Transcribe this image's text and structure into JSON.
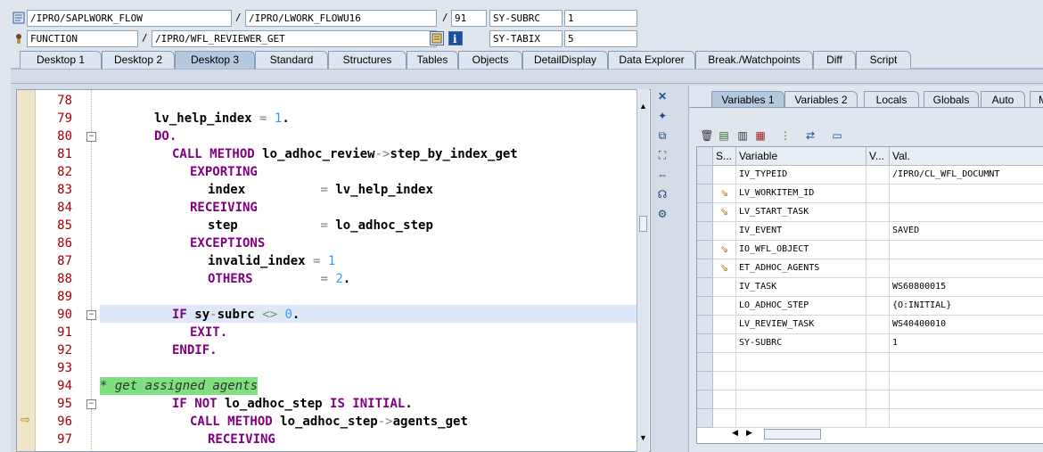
{
  "top": {
    "row1": {
      "program": "/IPRO/SAPLWORK_FLOW",
      "include": "/IPRO/LWORK_FLOWU16",
      "line": "91",
      "var_name": "SY-SUBRC",
      "var_value": "1"
    },
    "row2": {
      "type": "FUNCTION",
      "name": "/IPRO/WFL_REVIEWER_GET",
      "var_name": "SY-TABIX",
      "var_value": "5"
    },
    "slash": "/"
  },
  "desktop_tabs": [
    "Desktop 1",
    "Desktop 2",
    "Desktop 3",
    "Standard",
    "Structures",
    "Tables",
    "Objects",
    "DetailDisplay",
    "Data Explorer",
    "Break./Watchpoints",
    "Diff",
    "Script"
  ],
  "active_desktop_tab": "Desktop 3",
  "code_lines": [
    {
      "num": "78",
      "text": ""
    },
    {
      "num": "79",
      "text": "lv_help_index = 1."
    },
    {
      "num": "80",
      "text": "DO."
    },
    {
      "num": "81",
      "text": "CALL METHOD lo_adhoc_review->step_by_index_get"
    },
    {
      "num": "82",
      "text": "EXPORTING"
    },
    {
      "num": "83",
      "text": "index          = lv_help_index"
    },
    {
      "num": "84",
      "text": "RECEIVING"
    },
    {
      "num": "85",
      "text": "step           = lo_adhoc_step"
    },
    {
      "num": "86",
      "text": "EXCEPTIONS"
    },
    {
      "num": "87",
      "text": "invalid_index = 1"
    },
    {
      "num": "88",
      "text": "OTHERS         = 2."
    },
    {
      "num": "89",
      "text": ""
    },
    {
      "num": "90",
      "text": "IF sy-subrc <> 0."
    },
    {
      "num": "91",
      "text": "EXIT."
    },
    {
      "num": "92",
      "text": "ENDIF."
    },
    {
      "num": "93",
      "text": ""
    },
    {
      "num": "94",
      "text": "* get assigned agents"
    },
    {
      "num": "95",
      "text": "IF NOT lo_adhoc_step IS INITIAL."
    },
    {
      "num": "96",
      "text": "CALL METHOD lo_adhoc_step->agents_get"
    },
    {
      "num": "97",
      "text": "RECEIVING"
    }
  ],
  "var_tabs": [
    "Variables 1",
    "Variables 2",
    "Locals",
    "Globals",
    "Auto",
    "M"
  ],
  "active_var_tab": "Variables 1",
  "grid": {
    "headers": {
      "s": "S...",
      "variable": "Variable",
      "v": "V...",
      "val": "Val."
    },
    "rows": [
      {
        "variable": "IV_TYPEID",
        "value": "/IPRO/CL_WFL_DOCUMNT",
        "icon": ""
      },
      {
        "variable": "LV_WORKITEM_ID",
        "value": "",
        "icon": "change-icon"
      },
      {
        "variable": "LV_START_TASK",
        "value": "",
        "icon": "change-icon"
      },
      {
        "variable": "IV_EVENT",
        "value": "SAVED",
        "icon": ""
      },
      {
        "variable": "IO_WFL_OBJECT",
        "value": "",
        "icon": "change-icon"
      },
      {
        "variable": "ET_ADHOC_AGENTS",
        "value": "",
        "icon": "change-icon"
      },
      {
        "variable": "IV_TASK",
        "value": "WS60800015",
        "icon": ""
      },
      {
        "variable": "LO_ADHOC_STEP",
        "value": "{O:INITIAL}",
        "icon": ""
      },
      {
        "variable": "LV_REVIEW_TASK",
        "value": "WS40400010",
        "icon": ""
      },
      {
        "variable": "SY-SUBRC",
        "value": "1",
        "icon": ""
      }
    ]
  },
  "colors": {
    "keyword": "#800080",
    "number": "#3399ff",
    "comment_bg": "#7ee07e",
    "line_number": "#aa0000"
  }
}
